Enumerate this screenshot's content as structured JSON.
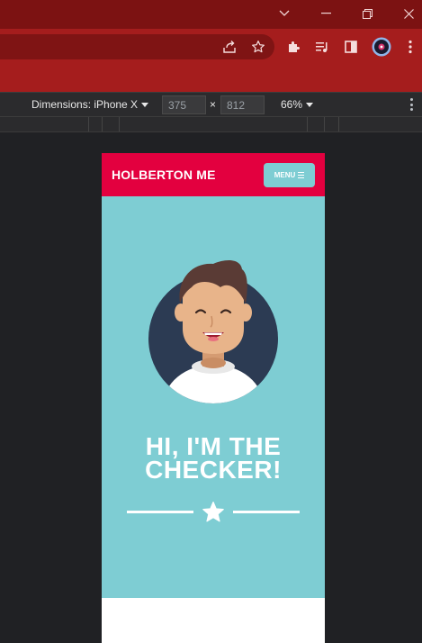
{
  "devtools": {
    "dimensions_label": "Dimensions: iPhone X",
    "width_value": "375",
    "height_value": "812",
    "times_sign": "×",
    "zoom_label": "66%"
  },
  "site": {
    "brand": "HOLBERTON ME",
    "menu_label": "MENU",
    "hero_title_line1": "HI, I'M THE",
    "hero_title_line2": "CHECKER!"
  },
  "colors": {
    "header_red": "#e3003f",
    "hero_teal": "#7ecdd3",
    "browser_frame": "#a51d1d"
  }
}
